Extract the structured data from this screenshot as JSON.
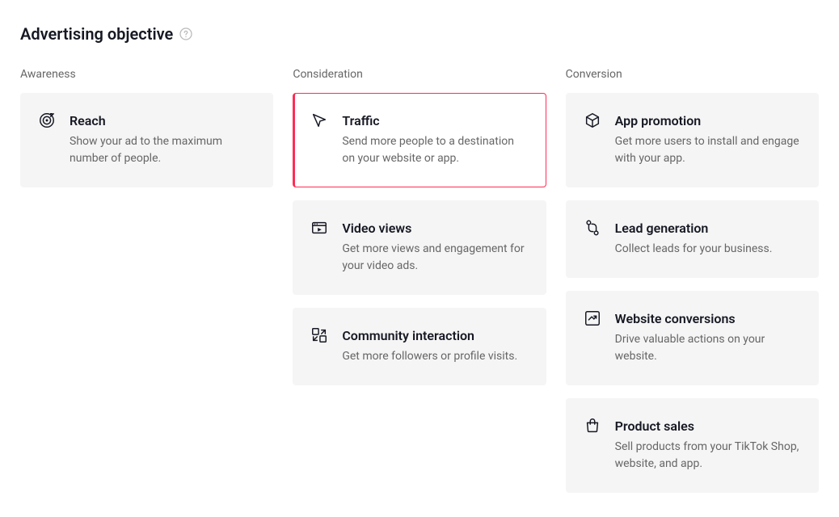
{
  "header": {
    "title": "Advertising objective"
  },
  "columns": {
    "awareness": {
      "label": "Awareness",
      "cards": {
        "reach": {
          "title": "Reach",
          "desc": "Show your ad to the maximum number of people."
        }
      }
    },
    "consideration": {
      "label": "Consideration",
      "cards": {
        "traffic": {
          "title": "Traffic",
          "desc": "Send more people to a destination on your website or app."
        },
        "video_views": {
          "title": "Video views",
          "desc": "Get more views and engagement for your video ads."
        },
        "community": {
          "title": "Community interaction",
          "desc": "Get more followers or profile visits."
        }
      }
    },
    "conversion": {
      "label": "Conversion",
      "cards": {
        "app_promo": {
          "title": "App promotion",
          "desc": "Get more users to install and engage with your app."
        },
        "lead_gen": {
          "title": "Lead generation",
          "desc": "Collect leads for your business."
        },
        "website_conv": {
          "title": "Website conversions",
          "desc": "Drive valuable actions on your website."
        },
        "product_sales": {
          "title": "Product sales",
          "desc": "Sell products from your TikTok Shop, website, and app."
        }
      }
    }
  }
}
